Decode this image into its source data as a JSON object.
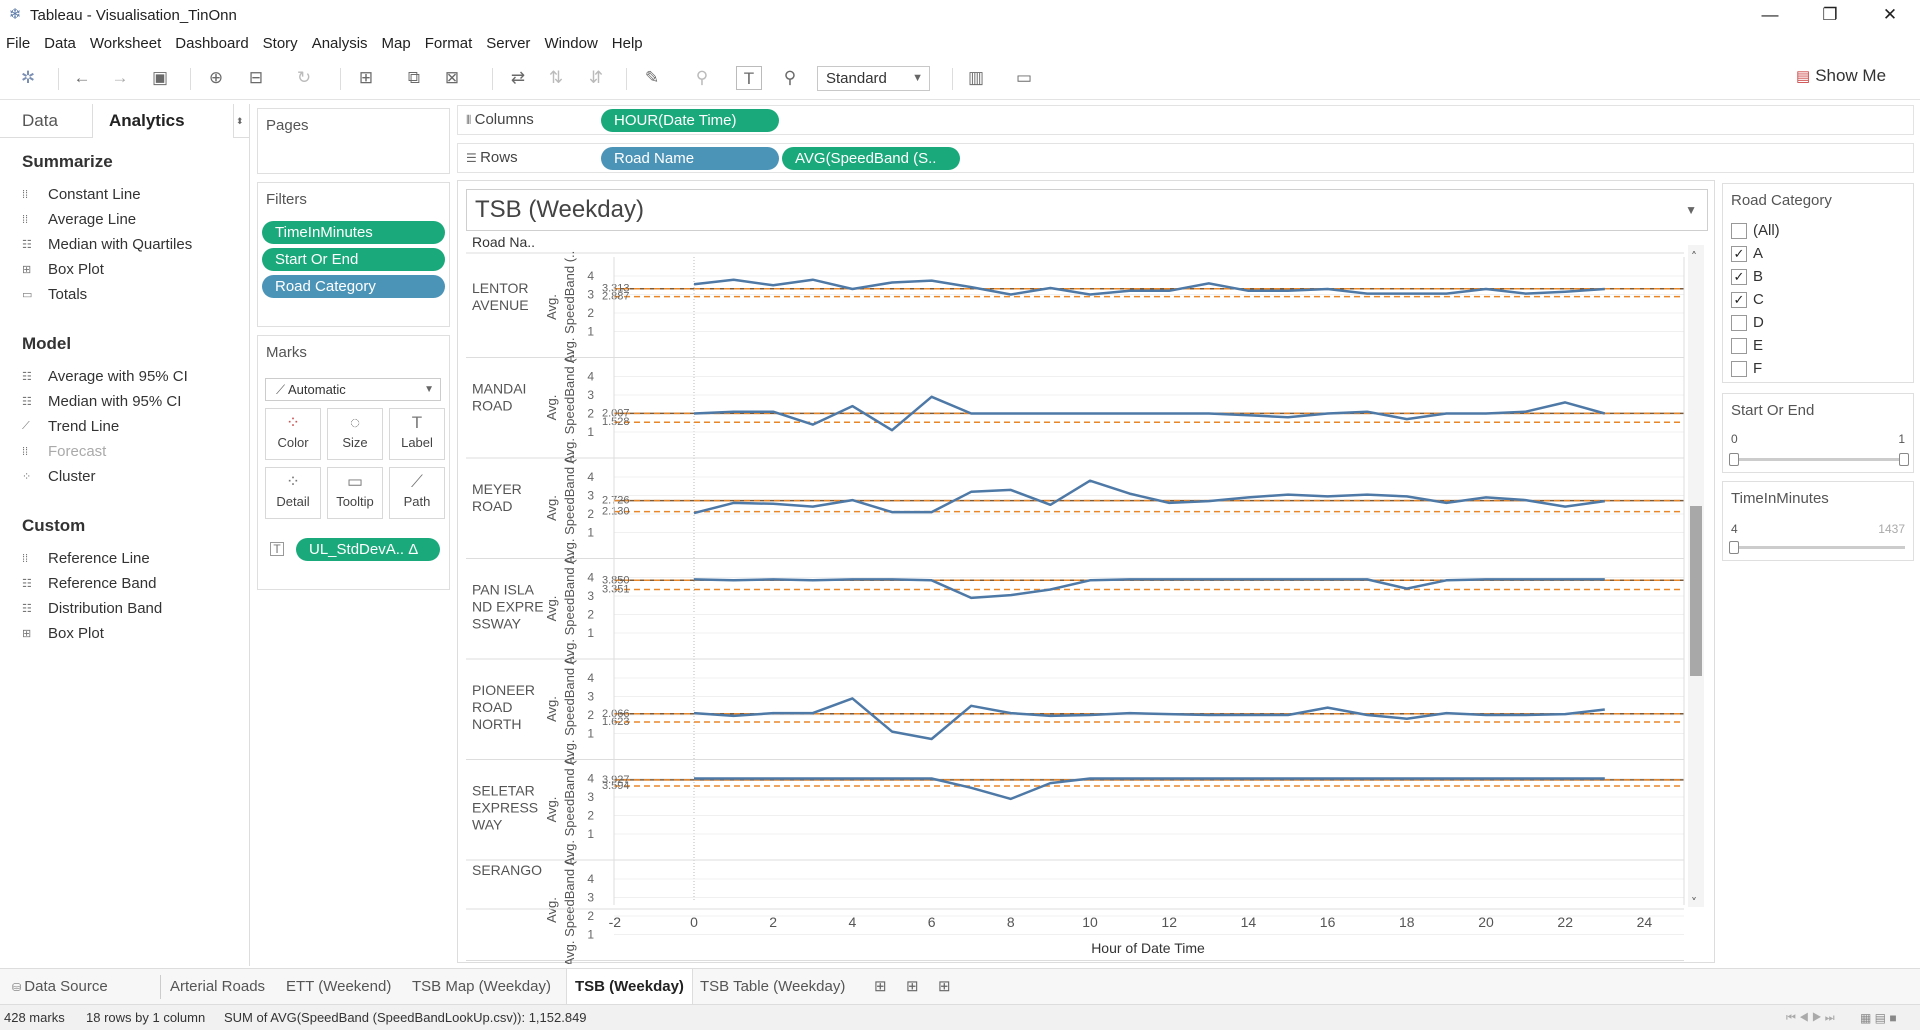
{
  "window": {
    "title": "Tableau - Visualisation_TinOnn"
  },
  "menu": [
    "File",
    "Data",
    "Worksheet",
    "Dashboard",
    "Story",
    "Analysis",
    "Map",
    "Format",
    "Server",
    "Window",
    "Help"
  ],
  "toolbar": {
    "fit_mode": "Standard",
    "show_me": "Show Me"
  },
  "left_panel": {
    "tabs": {
      "data": "Data",
      "analytics": "Analytics"
    },
    "summarize": {
      "title": "Summarize",
      "items": [
        "Constant Line",
        "Average Line",
        "Median with Quartiles",
        "Box Plot",
        "Totals"
      ]
    },
    "model": {
      "title": "Model",
      "items": [
        "Average with 95% CI",
        "Median with 95% CI",
        "Trend Line",
        "Forecast",
        "Cluster"
      ]
    },
    "custom": {
      "title": "Custom",
      "items": [
        "Reference Line",
        "Reference Band",
        "Distribution Band",
        "Box Plot"
      ]
    }
  },
  "pages": {
    "title": "Pages"
  },
  "filters": {
    "title": "Filters",
    "pills": [
      "TimeInMinutes",
      "Start Or End",
      "Road Category"
    ]
  },
  "marks": {
    "title": "Marks",
    "type": "Automatic",
    "buttons": [
      "Color",
      "Size",
      "Label",
      "Detail",
      "Tooltip",
      "Path"
    ],
    "pill": "UL_StdDevA.. Δ"
  },
  "shelves": {
    "columns_label": "Columns",
    "columns_pill": "HOUR(Date Time)",
    "rows_label": "Rows",
    "rows_pills": [
      "Road Name",
      "AVG(SpeedBand (S.."
    ]
  },
  "sheet": {
    "title": "TSB (Weekday)",
    "row_header": "Road Na.."
  },
  "road_category": {
    "title": "Road Category",
    "options": [
      {
        "label": "(All)",
        "checked": false
      },
      {
        "label": "A",
        "checked": true
      },
      {
        "label": "B",
        "checked": true
      },
      {
        "label": "C",
        "checked": true
      },
      {
        "label": "D",
        "checked": false
      },
      {
        "label": "E",
        "checked": false
      },
      {
        "label": "F",
        "checked": false
      }
    ]
  },
  "start_or_end": {
    "title": "Start Or End",
    "min": "0",
    "max": "1",
    "low": 0,
    "high": 1
  },
  "time_in_minutes": {
    "title": "TimeInMinutes",
    "min": "4",
    "max": "1437",
    "low": 4,
    "high": 1437
  },
  "sheet_tabs": [
    "Data Source",
    "Arterial Roads",
    "ETT (Weekend)",
    "TSB Map (Weekday)",
    "TSB (Weekday)",
    "TSB Table (Weekday)"
  ],
  "active_tab": "TSB (Weekday)",
  "status": {
    "marks": "428 marks",
    "dims": "18 rows by 1 column",
    "sum": "SUM of AVG(SpeedBand (SpeedBandLookUp.csv)): 1,152.849"
  },
  "colors": {
    "line": "#4e79a7",
    "ref_line": "#e8872a",
    "pill_green": "#1aa97a",
    "pill_blue": "#4b94b8"
  },
  "chart_data": {
    "type": "line",
    "xlabel": "Hour of Date Time",
    "ylabel": "Avg. SpeedBand (..",
    "x_ticks": [
      -2,
      0,
      2,
      4,
      6,
      8,
      10,
      12,
      14,
      16,
      18,
      20,
      22,
      24
    ],
    "y_ticks": [
      1,
      2,
      3,
      4
    ],
    "xlim": [
      -2,
      25
    ],
    "ylim": [
      0,
      4.5
    ],
    "x": [
      0,
      1,
      2,
      3,
      4,
      5,
      6,
      7,
      8,
      9,
      10,
      11,
      12,
      13,
      14,
      15,
      16,
      17,
      18,
      19,
      20,
      21,
      22,
      23
    ],
    "series": [
      {
        "name": "LENTOR AVENUE",
        "avg_label": "3.313",
        "lower_label": "2.887",
        "avg": 3.313,
        "lower": 2.887,
        "values": [
          3.55,
          3.8,
          3.5,
          3.8,
          3.3,
          3.65,
          3.75,
          3.4,
          3.0,
          3.35,
          3.0,
          3.2,
          3.2,
          3.6,
          3.2,
          3.2,
          3.3,
          3.05,
          3.05,
          3.05,
          3.3,
          3.05,
          3.15,
          3.3
        ]
      },
      {
        "name": "MANDAI ROAD",
        "avg_label": "2.007",
        "lower_label": "1.528",
        "avg": 2.007,
        "lower": 1.528,
        "values": [
          2.0,
          2.1,
          2.1,
          1.4,
          2.4,
          1.1,
          2.9,
          2.0,
          2.0,
          2.0,
          2.0,
          2.0,
          2.0,
          2.0,
          1.9,
          1.8,
          2.0,
          2.1,
          1.7,
          2.0,
          2.0,
          2.1,
          2.6,
          2.0
        ]
      },
      {
        "name": "MEYER ROAD",
        "avg_label": "2.726",
        "lower_label": "2.130",
        "avg": 2.726,
        "lower": 2.13,
        "values": [
          2.05,
          2.6,
          2.55,
          2.4,
          2.75,
          2.1,
          2.1,
          3.2,
          3.3,
          2.5,
          3.8,
          3.1,
          2.6,
          2.7,
          2.9,
          3.05,
          2.95,
          3.05,
          2.95,
          2.6,
          2.9,
          2.75,
          2.4,
          2.7
        ]
      },
      {
        "name": "PAN ISLAND EXPRESSWAY",
        "display_name": [
          "PAN ISLA",
          "ND EXPRE",
          "SSWAY"
        ],
        "avg_label": "3.850",
        "lower_label": "3.351",
        "avg": 3.85,
        "lower": 3.351,
        "values": [
          3.9,
          3.85,
          3.9,
          3.85,
          3.9,
          3.9,
          3.85,
          2.9,
          3.05,
          3.35,
          3.85,
          3.9,
          3.9,
          3.9,
          3.9,
          3.9,
          3.9,
          3.9,
          3.4,
          3.85,
          3.9,
          3.9,
          3.9,
          3.9
        ]
      },
      {
        "name": "PIONEER ROAD NORTH",
        "display_name": [
          "PIONEER",
          "ROAD",
          "NORTH"
        ],
        "avg_label": "2.066",
        "lower_label": "1.623",
        "avg": 2.066,
        "lower": 1.623,
        "values": [
          2.1,
          1.95,
          2.1,
          2.1,
          2.9,
          1.1,
          0.7,
          2.5,
          2.1,
          1.95,
          2.0,
          2.1,
          2.05,
          2.0,
          2.0,
          2.0,
          2.4,
          2.0,
          1.8,
          2.1,
          2.0,
          2.0,
          2.05,
          2.3
        ]
      },
      {
        "name": "SELETAR EXPRESSWAY",
        "display_name": [
          "SELETAR",
          "EXPRESS",
          "WAY"
        ],
        "avg_label": "3.927",
        "lower_label": "3.594",
        "avg": 3.927,
        "lower": 3.594,
        "values": [
          4.0,
          4.0,
          4.0,
          4.0,
          4.0,
          4.0,
          4.0,
          3.5,
          2.9,
          3.75,
          4.0,
          4.0,
          4.0,
          4.0,
          4.0,
          4.0,
          4.0,
          4.0,
          4.0,
          4.0,
          4.0,
          4.0,
          4.0,
          4.0
        ]
      },
      {
        "name": "SERANGO",
        "partial": true,
        "values": []
      }
    ]
  }
}
